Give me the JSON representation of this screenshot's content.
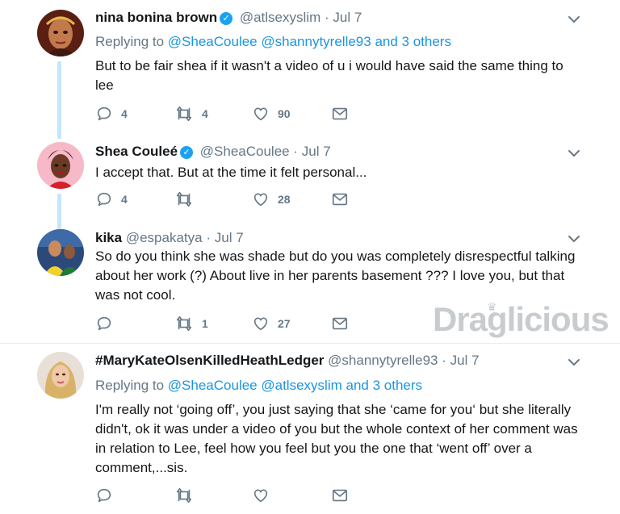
{
  "watermark": {
    "text": "Draglicious",
    "crown": "♛"
  },
  "tweets": [
    {
      "name": "nina bonina brown",
      "verified_mark": "✓",
      "handle": "@atlsexyslim",
      "dot": "·",
      "date": "Jul 7",
      "replying_prefix": "Replying to",
      "mention1": "@SheaCoulee",
      "mention2": "@shannytyrelle93",
      "others": "and 3 others",
      "text": "But to be fair shea if it wasn't a video of u i would have said the same thing to lee",
      "reply_count": "4",
      "retweet_count": "4",
      "like_count": "90"
    },
    {
      "name": "Shea Couleé",
      "verified_mark": "✓",
      "handle": "@SheaCoulee",
      "dot": "·",
      "date": "Jul 7",
      "text": "I accept that. But at the time it felt personal...",
      "reply_count": "4",
      "retweet_count": "",
      "like_count": "28"
    },
    {
      "name": "kika",
      "handle": "@espakatya",
      "dot": "·",
      "date": "Jul 7",
      "text": "So do you think she was shade but do you was completely disrespectful talking about her work (?) About live in her parents basement ??? I love you, but that was not cool.",
      "reply_count": "",
      "retweet_count": "1",
      "like_count": "27"
    },
    {
      "name": "#MaryKateOlsenKilledHeathLedger",
      "handle": "@shannytyrelle93",
      "dot": "·",
      "date": "Jul 7",
      "replying_prefix": "Replying to",
      "mention1": "@SheaCoulee",
      "mention2": "@atlsexyslim",
      "others": "and 3 others",
      "text": "I'm really not ‘going off’, you just saying that she ‘came for you‘ but she literally didn't, ok it was under a video of you but the whole context of her comment was in relation to Lee, feel how you feel but you the one that ‘went off’ over a comment,...sis.",
      "reply_count": "",
      "retweet_count": "",
      "like_count": ""
    }
  ]
}
